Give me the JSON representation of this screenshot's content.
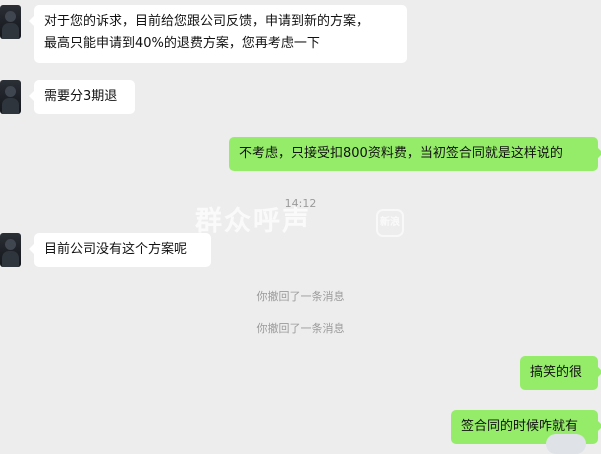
{
  "messages": [
    {
      "side": "left",
      "avatar": "user-avatar",
      "text": "对于您的诉求，目前给您跟公司反馈，申请到新的方案，\n最高只能申请到40%的退费方案，您再考虑一下"
    },
    {
      "side": "left",
      "avatar": "user-avatar",
      "text": "需要分3期退"
    },
    {
      "side": "right",
      "text": "不考虑，只接受扣800资料费，当初签合同就是这样说的"
    },
    {
      "side": "time",
      "text": "14:12"
    },
    {
      "side": "left",
      "avatar": "user-avatar",
      "text": "目前公司没有这个方案呢"
    },
    {
      "side": "system",
      "text": "你撤回了一条消息"
    },
    {
      "side": "system",
      "text": "你撤回了一条消息"
    },
    {
      "side": "right",
      "text": "搞笑的很"
    },
    {
      "side": "right",
      "text": "签合同的时候咋就有"
    }
  ],
  "watermark": {
    "text": "群众呼声",
    "logo": "新浪"
  },
  "theme": {
    "background": "#ededed",
    "outgoing_bubble": "#95ec69",
    "incoming_bubble": "#ffffff",
    "system_text": "#9b9b9b"
  }
}
